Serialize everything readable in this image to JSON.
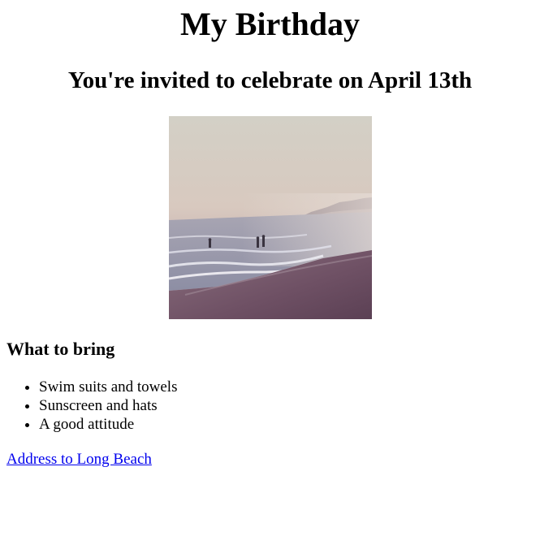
{
  "heading": "My Birthday",
  "subheading": "You're invited to celebrate on April 13th",
  "image": {
    "alt": "Beach at dusk with waves and people in the water"
  },
  "bring": {
    "title": "What to bring",
    "items": [
      "Swim suits and towels",
      "Sunscreen and hats",
      "A good attitude"
    ]
  },
  "address_link": {
    "label": "Address to Long Beach"
  },
  "colors": {
    "link": "#0000ee",
    "text": "#000000",
    "background": "#ffffff"
  }
}
